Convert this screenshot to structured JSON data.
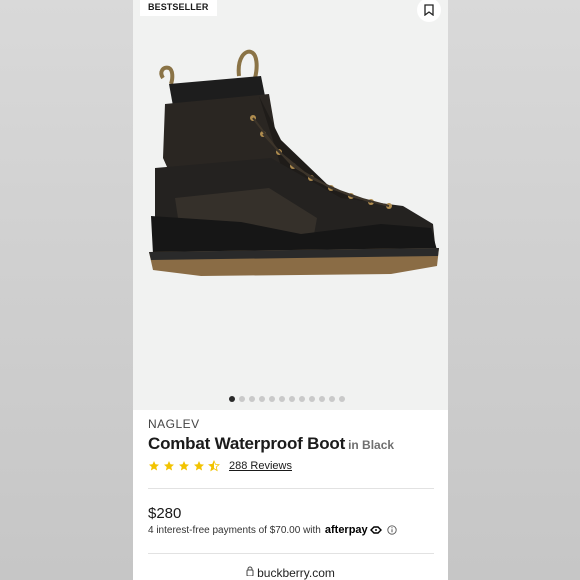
{
  "badge": "BESTSELLER",
  "product": {
    "brand": "NAGLEV",
    "title": "Combat Waterproof Boot",
    "color": "in Black",
    "rating": 4.5,
    "reviews": "288 Reviews",
    "price": "$280",
    "installments_text": "4 interest-free payments of $70.00 with",
    "afterpay_label": "afterpay"
  },
  "gallery": {
    "total": 12,
    "active_index": 0
  },
  "browser": {
    "url": "buckberry.com"
  },
  "icons": {
    "save": "bookmark-icon",
    "star": "star-icon",
    "info": "info-icon",
    "lock": "lock-icon"
  },
  "colors": {
    "star": "#f2c300",
    "hero_background": "#f1f2f1",
    "active_dot": "#2a2a2a"
  }
}
